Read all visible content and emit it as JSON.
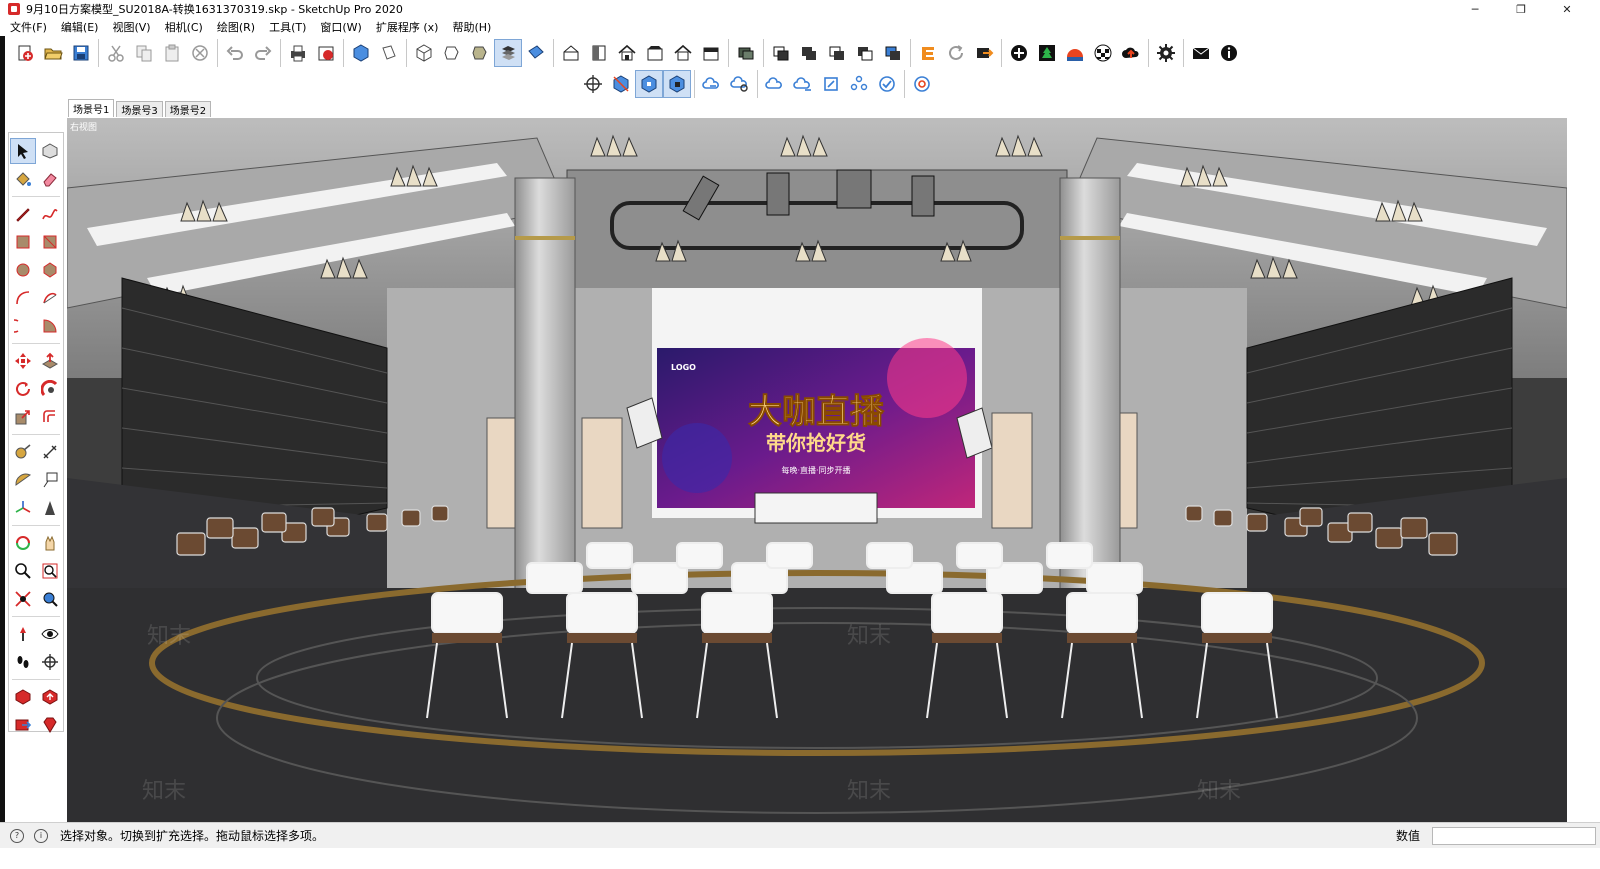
{
  "window": {
    "title": "9月10日方案模型_SU2018A-转换1631370319.skp - SketchUp Pro 2020",
    "minimize": "─",
    "maximize": "❐",
    "close": "✕"
  },
  "menu": [
    "文件(F)",
    "编辑(E)",
    "视图(V)",
    "相机(C)",
    "绘图(R)",
    "工具(T)",
    "窗口(W)",
    "扩展程序 (x)",
    "帮助(H)"
  ],
  "scene_tabs": [
    "场景号1",
    "场景号3",
    "场景号2"
  ],
  "viewport": {
    "label": "右视图",
    "banner_logo": "LOGO",
    "banner_title": "大咖直播",
    "banner_subtitle": "带你抢好货",
    "banner_footer": "每晚·直播·同步开播",
    "watermark": "知末"
  },
  "statusbar": {
    "hint": "选择对象。切换到扩充选择。拖动鼠标选择多项。",
    "measure_label": "数值",
    "info_icon": "i"
  },
  "colors": {
    "accent_red": "#d62a2a",
    "toolbar_blue": "#3a7fd5",
    "ceiling": "#cfcfcf",
    "floor": "#2f2f31",
    "ring": "#8a6a2e"
  }
}
